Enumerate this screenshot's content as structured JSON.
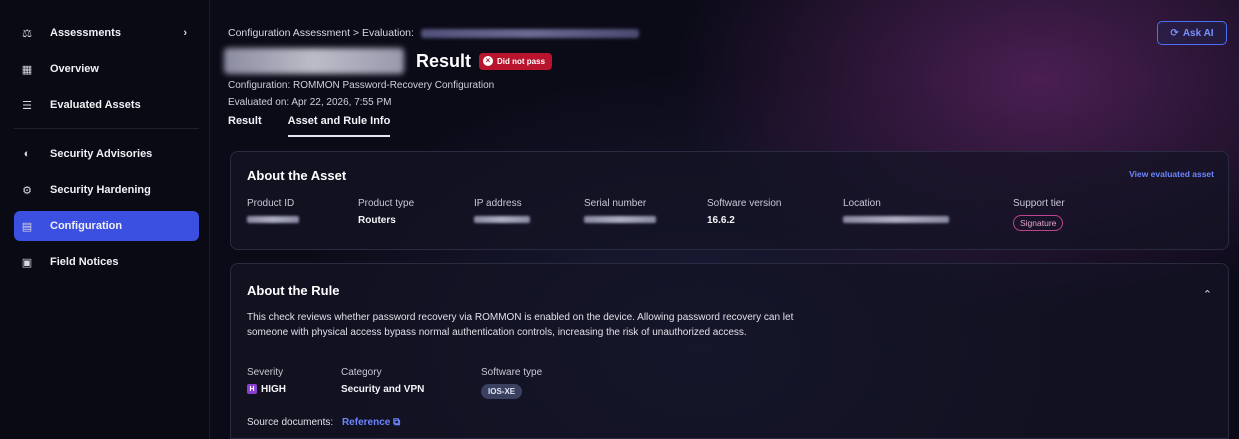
{
  "sidebar": {
    "items": [
      {
        "label": "Assessments",
        "icon": "scales-icon",
        "glyph": "⚖"
      },
      {
        "label": "Overview",
        "icon": "dashboard-icon",
        "glyph": "▦"
      },
      {
        "label": "Evaluated Assets",
        "icon": "list-icon",
        "glyph": "☰"
      },
      {
        "label": "Security Advisories",
        "icon": "shield-icon",
        "glyph": "◐"
      },
      {
        "label": "Security Hardening",
        "icon": "hardening-icon",
        "glyph": "⚙"
      },
      {
        "label": "Configuration",
        "icon": "config-doc-icon",
        "glyph": "▤"
      },
      {
        "label": "Field Notices",
        "icon": "notice-icon",
        "glyph": "▣"
      }
    ],
    "chevron": "›"
  },
  "header": {
    "breadcrumb_root": "Configuration Assessment",
    "breadcrumb_sep": ">",
    "breadcrumb_current": "Evaluation:",
    "title": "Result",
    "status_badge": "Did not pass",
    "configuration": "Configuration: ROMMON Password-Recovery Configuration",
    "evaluated_on": "Evaluated on: Apr 22, 2026, 7:55 PM",
    "ask_ai": "Ask AI"
  },
  "tabs": [
    "Result",
    "Asset and Rule Info"
  ],
  "asset": {
    "title": "About the Asset",
    "view_link": "View evaluated asset",
    "product_id_label": "Product ID",
    "product_type_label": "Product type",
    "product_type": "Routers",
    "ip_label": "IP address",
    "serial_label": "Serial number",
    "software_version_label": "Software version",
    "software_version": "16.6.2",
    "location_label": "Location",
    "support_tier_label": "Support tier",
    "support_tier": "Signature"
  },
  "rule": {
    "title": "About the Rule",
    "description": "This check reviews whether password recovery via ROMMON is enabled on the device. Allowing password recovery can let someone with physical access bypass normal authentication controls, increasing the risk of unauthorized access.",
    "severity_label": "Severity",
    "severity": "HIGH",
    "severity_mark": "H",
    "category_label": "Category",
    "category": "Security and VPN",
    "software_type_label": "Software type",
    "software_type": "IOS-XE",
    "source_label": "Source documents:",
    "reference": "Reference"
  },
  "colors": {
    "accent": "#3b4fe0",
    "fail": "#b8142e",
    "link": "#6b86ff",
    "severity_high": "#8a3fd0"
  }
}
